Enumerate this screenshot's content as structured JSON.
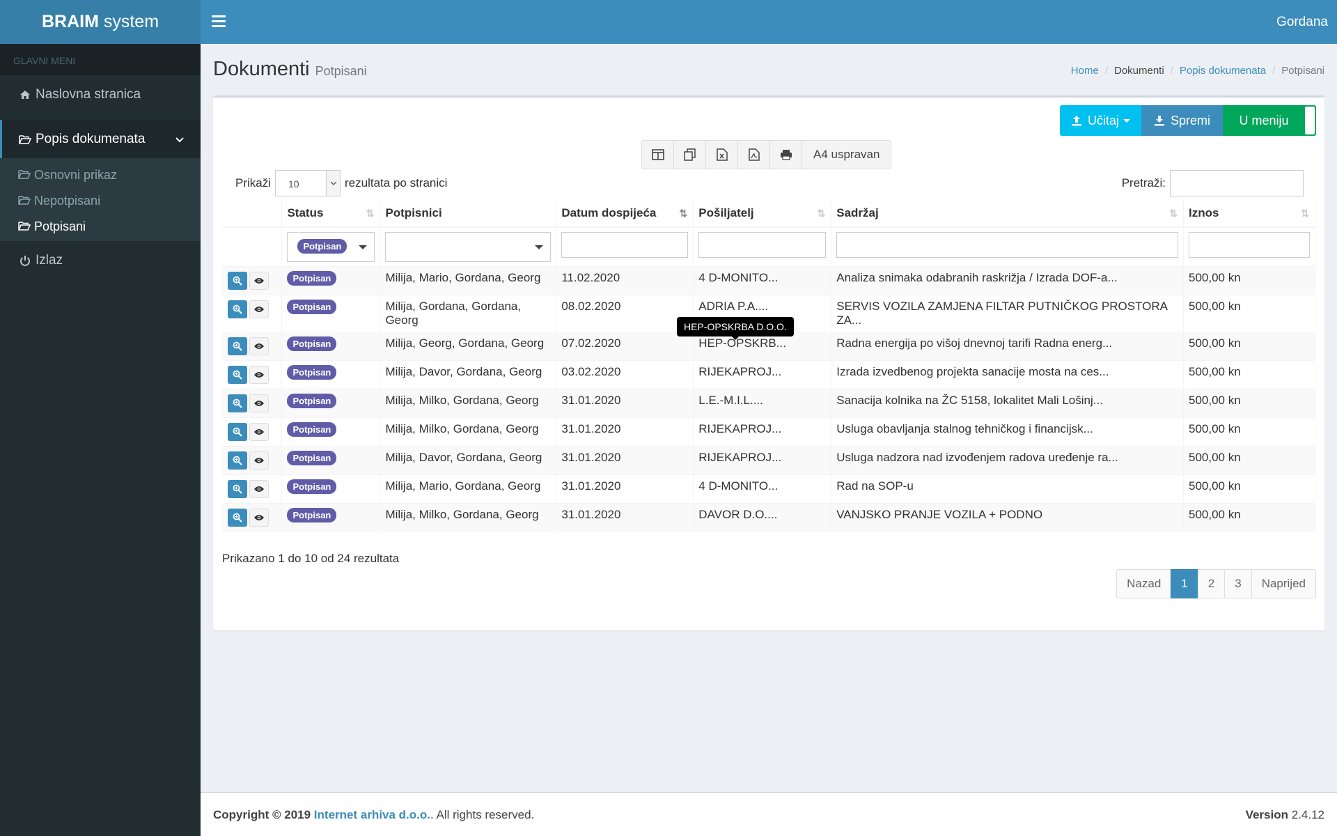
{
  "header": {
    "logo_bold": "BRAIM",
    "logo_rest": " system",
    "user": "Gordana"
  },
  "sidebar": {
    "section_title": "GLAVNI MENI",
    "home": "Naslovna stranica",
    "docs": "Popis dokumenata",
    "sub": [
      "Osnovni prikaz",
      "Nepotpisani",
      "Potpisani"
    ],
    "logout": "Izlaz"
  },
  "page": {
    "title": "Dokumenti",
    "subtitle": "Potpisani",
    "breadcrumb": [
      "Home",
      "Dokumenti",
      "Popis dokumenata",
      "Potpisani"
    ]
  },
  "toolbar": {
    "ucitaj": "Učitaj",
    "spremi": "Spremi",
    "u_meniju": "U meniju",
    "paper": "A4 uspravan"
  },
  "controls": {
    "show_prefix": "Prikaži",
    "page_length": "10",
    "show_suffix": "rezultata po stranici",
    "search_label": "Pretraži:"
  },
  "table": {
    "columns": [
      "Status",
      "Potpisnici",
      "Datum dospijeća",
      "Pošiljatelj",
      "Sadržaj",
      "Iznos"
    ],
    "status_filter": "Potpisan",
    "rows": [
      {
        "status": "Potpisan",
        "signers": "Milija, Mario, Gordana, Georg",
        "date": "11.02.2020",
        "sender": "4 D-MONITO...",
        "content": "Analiza snimaka odabranih raskrižja / Izrada DOF-a...",
        "amount": "500,00 kn"
      },
      {
        "status": "Potpisan",
        "signers": "Milija, Gordana, Gordana, Georg",
        "date": "08.02.2020",
        "sender": "ADRIA P.A....",
        "content": "SERVIS VOZILA ZAMJENA FILTAR PUTNIČKOG PROSTORA ZA...",
        "amount": "500,00 kn"
      },
      {
        "status": "Potpisan",
        "signers": "Milija, Georg, Gordana, Georg",
        "date": "07.02.2020",
        "sender": "HEP-OPSKRB...",
        "content": "Radna energija po višoj dnevnoj tarifi Radna energ...",
        "amount": "500,00 kn"
      },
      {
        "status": "Potpisan",
        "signers": "Milija, Davor, Gordana, Georg",
        "date": "03.02.2020",
        "sender": "RIJEKAPROJ...",
        "content": "Izrada izvedbenog projekta sanacije mosta na ces...",
        "amount": "500,00 kn"
      },
      {
        "status": "Potpisan",
        "signers": "Milija, Milko, Gordana, Georg",
        "date": "31.01.2020",
        "sender": "L.E.-M.I.L....",
        "content": "Sanacija kolnika na ŽC 5158, lokalitet Mali Lošinj...",
        "amount": "500,00 kn"
      },
      {
        "status": "Potpisan",
        "signers": "Milija, Milko, Gordana, Georg",
        "date": "31.01.2020",
        "sender": "RIJEKAPROJ...",
        "content": "Usluga obavljanja stalnog tehničkog i financijsk...",
        "amount": "500,00 kn"
      },
      {
        "status": "Potpisan",
        "signers": "Milija, Davor, Gordana, Georg",
        "date": "31.01.2020",
        "sender": "RIJEKAPROJ...",
        "content": "Usluga nadzora nad izvođenjem radova uređenje ra...",
        "amount": "500,00 kn"
      },
      {
        "status": "Potpisan",
        "signers": "Milija, Mario, Gordana, Georg",
        "date": "31.01.2020",
        "sender": "4 D-MONITO...",
        "content": "Rad na SOP-u",
        "amount": "500,00 kn"
      },
      {
        "status": "Potpisan",
        "signers": "Milija, Milko, Gordana, Georg",
        "date": "31.01.2020",
        "sender": "DAVOR D.O....",
        "content": "VANJSKO PRANJE VOZILA + PODNO",
        "amount": "500,00 kn"
      }
    ]
  },
  "tooltip": "HEP-OPSKRBA D.O.O.",
  "info": "Prikazano 1 do 10 od 24 rezultata",
  "pager": {
    "prev": "Nazad",
    "pages": [
      "1",
      "2",
      "3"
    ],
    "next": "Naprijed"
  },
  "footer": {
    "copyright": "Copyright © 2019",
    "company": "Internet arhiva d.o.o.",
    "rights": ". All rights reserved.",
    "version_label": "Version",
    "version": "2.4.12"
  },
  "colors": {
    "header": "#3c8dbc",
    "sidebar": "#222d32",
    "badge": "#605ca8",
    "success": "#00a65a",
    "info": "#00c0ef"
  }
}
